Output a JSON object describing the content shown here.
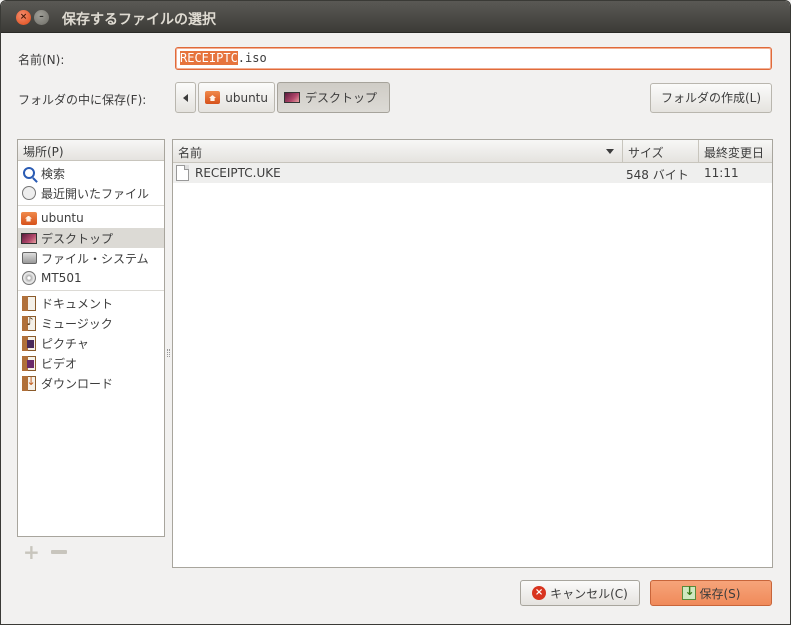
{
  "window": {
    "title": "保存するファイルの選択"
  },
  "name_row": {
    "label": "名前(N):",
    "value_selected": "RECEIPTC",
    "value_rest": ".iso"
  },
  "folder_row": {
    "label": "フォルダの中に保存(F):",
    "path": [
      "ubuntu",
      "デスクトップ"
    ],
    "create_folder_label": "フォルダの作成(L)"
  },
  "places": {
    "header": "場所(P)",
    "groups": [
      [
        {
          "label": "検索",
          "icon": "search-icon"
        },
        {
          "label": "最近開いたファイル",
          "icon": "recent-icon"
        }
      ],
      [
        {
          "label": "ubuntu",
          "icon": "home-folder-icon"
        },
        {
          "label": "デスクトップ",
          "icon": "desktop-icon",
          "selected": true
        },
        {
          "label": "ファイル・システム",
          "icon": "drive-icon"
        },
        {
          "label": "MT501",
          "icon": "cd-icon"
        }
      ],
      [
        {
          "label": "ドキュメント",
          "icon": "documents-icon"
        },
        {
          "label": "ミュージック",
          "icon": "music-icon"
        },
        {
          "label": "ピクチャ",
          "icon": "pictures-icon"
        },
        {
          "label": "ビデオ",
          "icon": "videos-icon"
        },
        {
          "label": "ダウンロード",
          "icon": "downloads-icon"
        }
      ]
    ]
  },
  "files": {
    "columns": {
      "name": "名前",
      "size": "サイズ",
      "modified": "最終変更日"
    },
    "rows": [
      {
        "name": "RECEIPTC.UKE",
        "size": "548 バイト",
        "modified": "11:11"
      }
    ]
  },
  "buttons": {
    "cancel": "キャンセル(C)",
    "save": "保存(S)"
  }
}
